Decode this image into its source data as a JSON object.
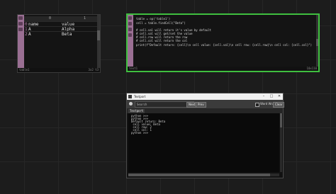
{
  "table_dat": {
    "columns": [
      "0",
      "1"
    ],
    "rows": [
      {
        "index": "0",
        "c0": "name",
        "c1": "value"
      },
      {
        "index": "1",
        "c0": "A",
        "c1": "Alpha"
      },
      {
        "index": "2",
        "c0": "A",
        "c1": "Beta"
      }
    ],
    "name": "table1",
    "size": "3x2 t3"
  },
  "text_dat": {
    "lines": [
      "table = op('table1')",
      "cell = table.findCell(\"Beta\")",
      "",
      "# cell.val will return it's value by default",
      "# cell.val will get/set the value",
      "# cell.row will return the row",
      "# cell.col will return the col",
      "print(f\"Default return: {cell}\\n cell value: {cell.val}\\n cell row: {cell.row}\\n cell col: {cell.col}\")"
    ],
    "name": "text1",
    "size": "10x110"
  },
  "textport": {
    "title": "Textport",
    "search_placeholder": "Search",
    "buttons": {
      "next": "Next",
      "prev": "Prev",
      "clear": "Clear"
    },
    "word_wrap_label": "Word Wrap",
    "tab_label": "Textport",
    "output": [
      "python >>>",
      "python >>>",
      "Default return: Beta",
      " cell value: Beta",
      " cell row: 2",
      " cell col: 1",
      "python >>>"
    ]
  },
  "colors": {
    "background": "#1c1c1c",
    "node_strip": "#9a6f93",
    "selected_border": "#3fbf3f"
  }
}
